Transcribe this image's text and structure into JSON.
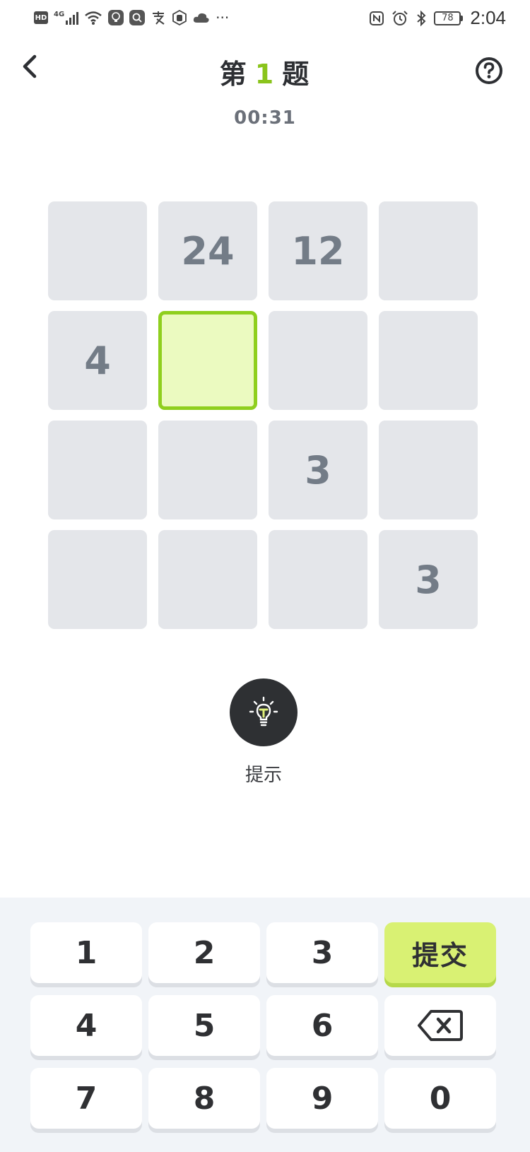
{
  "status_bar": {
    "left_icons": [
      "hd-badge-icon",
      "signal-4g-icon",
      "wifi-icon",
      "bulb-app-icon",
      "search-app-icon",
      "alipay-icon",
      "hand-app-icon",
      "cloud-icon",
      "more-dots-icon"
    ],
    "hd_label": "HD",
    "network_label": "4G",
    "more_label": "···",
    "right_icons": [
      "nfc-icon",
      "alarm-icon",
      "bluetooth-icon",
      "battery-icon"
    ],
    "battery": "78",
    "time": "2:04"
  },
  "header": {
    "title_prefix": "第",
    "title_number": "1",
    "title_suffix": "题",
    "timer": "00:31",
    "accent_color": "#8ac41c"
  },
  "grid": {
    "rows": [
      [
        "",
        "24",
        "12",
        ""
      ],
      [
        "4",
        "",
        "",
        ""
      ],
      [
        "",
        "",
        "3",
        ""
      ],
      [
        "",
        "",
        "",
        "3"
      ]
    ],
    "selected_cell": "row-2-col-2",
    "selected_color": "#ebfac0"
  },
  "hint": {
    "label": "提示"
  },
  "keypad": {
    "row1": [
      "1",
      "2",
      "3"
    ],
    "submit_label": "提交",
    "row2": [
      "4",
      "5",
      "6"
    ],
    "row3": [
      "7",
      "8",
      "9",
      "0"
    ],
    "submit_color": "#d9f173"
  }
}
